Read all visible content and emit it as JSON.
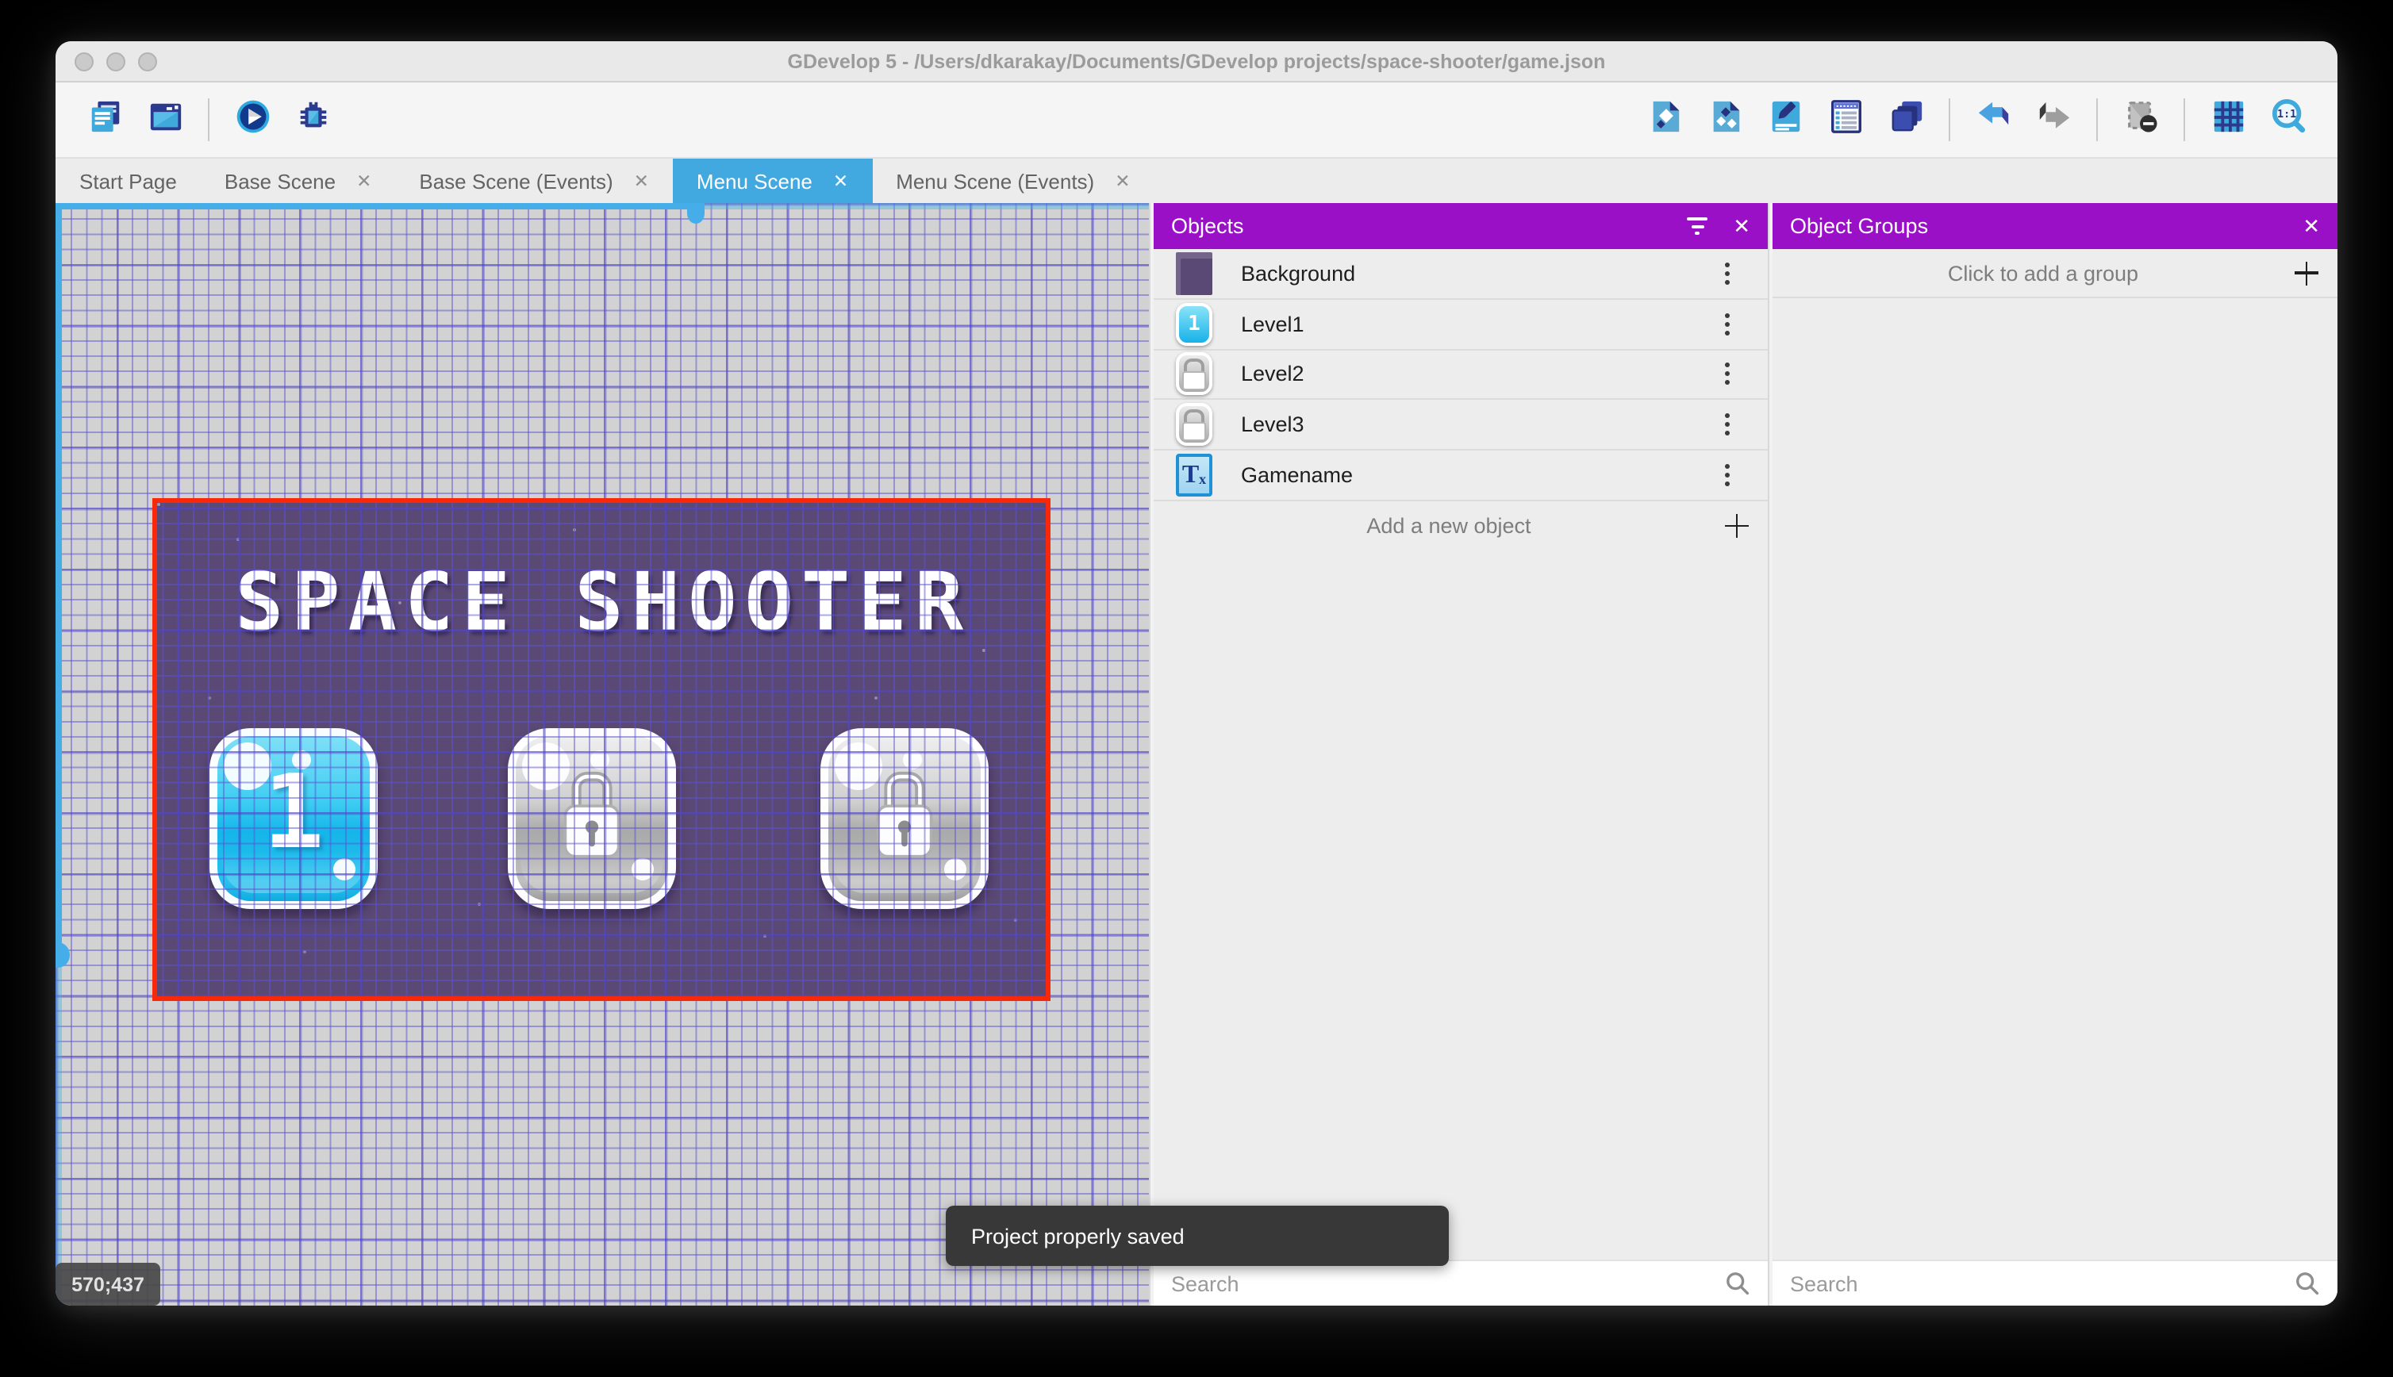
{
  "window": {
    "title": "GDevelop 5 - /Users/dkarakay/Documents/GDevelop projects/space-shooter/game.json"
  },
  "toolbar": {
    "left_icons": [
      "project-manager-icon",
      "scene-window-icon",
      "preview-play-icon",
      "debug-icon"
    ],
    "right_icons": [
      "objects-editor-icon",
      "object-groups-editor-icon",
      "properties-icon",
      "instances-list-icon",
      "layers-editor-icon",
      "undo-icon",
      "redo-icon",
      "toggle-window-mask-icon",
      "grid-icon",
      "zoom-icon"
    ],
    "zoom_icon_label": "1:1"
  },
  "tabs": [
    {
      "label": "Start Page",
      "closable": false,
      "active": false
    },
    {
      "label": "Base Scene",
      "closable": true,
      "active": false
    },
    {
      "label": "Base Scene (Events)",
      "closable": true,
      "active": false
    },
    {
      "label": "Menu Scene",
      "closable": true,
      "active": true
    },
    {
      "label": "Menu Scene (Events)",
      "closable": true,
      "active": false
    }
  ],
  "canvas": {
    "scene_title": "SPACE SHOOTER",
    "buttons": [
      {
        "label": "1",
        "state": "unlocked"
      },
      {
        "label": "",
        "state": "locked"
      },
      {
        "label": "",
        "state": "locked"
      }
    ],
    "coordinates": "570;437"
  },
  "toast": {
    "message": "Project properly saved"
  },
  "objects_panel": {
    "title": "Objects",
    "items": [
      {
        "name": "Background",
        "icon": "background-thumbnail"
      },
      {
        "name": "Level1",
        "icon": "level1-thumbnail"
      },
      {
        "name": "Level2",
        "icon": "lock-thumbnail"
      },
      {
        "name": "Level3",
        "icon": "lock-thumbnail"
      },
      {
        "name": "Gamename",
        "icon": "text-object-thumbnail"
      }
    ],
    "add_label": "Add a new object",
    "search_placeholder": "Search"
  },
  "groups_panel": {
    "title": "Object Groups",
    "empty_label": "Click to add a group",
    "search_placeholder": "Search"
  },
  "colors": {
    "accent_purple": "#9a10c7",
    "active_tab_blue": "#42a8e0",
    "scene_border_red": "#f8290b",
    "scene_background": "#5b4975",
    "grid_line": "#5c52d2",
    "scrollbar_blue": "#45aee8"
  }
}
